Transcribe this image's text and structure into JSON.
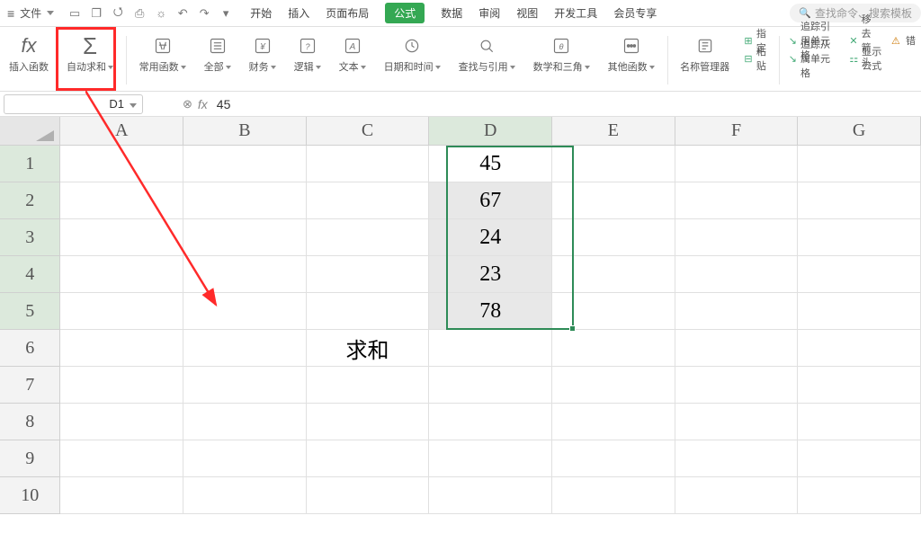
{
  "menu": {
    "file": "文件",
    "tabs": [
      "开始",
      "插入",
      "页面布局",
      "公式",
      "数据",
      "审阅",
      "视图",
      "开发工具",
      "会员专享"
    ],
    "active_tab_index": 3,
    "search_placeholder": "查找命令、搜索模板"
  },
  "ribbon": {
    "insert_fn": "插入函数",
    "autosum": "自动求和",
    "recent": "常用函数",
    "all": "全部",
    "financial": "财务",
    "logical": "逻辑",
    "text": "文本",
    "datetime": "日期和时间",
    "lookup": "查找与引用",
    "math": "数学和三角",
    "other": "其他函数",
    "name_mgr": "名称管理器",
    "paste": "粘贴",
    "specify": "指定",
    "trace_prec": "追踪引用单元格",
    "trace_dep": "追踪从属单元格",
    "move_arrow": "移去箭头",
    "show_formula": "显示公式",
    "err_chk": "错"
  },
  "namebox": "D1",
  "formula": "45",
  "grid": {
    "cols": [
      "A",
      "B",
      "C",
      "D",
      "E",
      "F",
      "G"
    ],
    "rows": [
      "1",
      "2",
      "3",
      "4",
      "5",
      "6",
      "7",
      "8",
      "9",
      "10"
    ],
    "cells": {
      "D1": "45",
      "D2": "67",
      "D3": "24",
      "D4": "23",
      "D5": "78",
      "C6": "求和"
    },
    "selection": {
      "col": "D",
      "row_from": 1,
      "row_to": 5
    }
  }
}
